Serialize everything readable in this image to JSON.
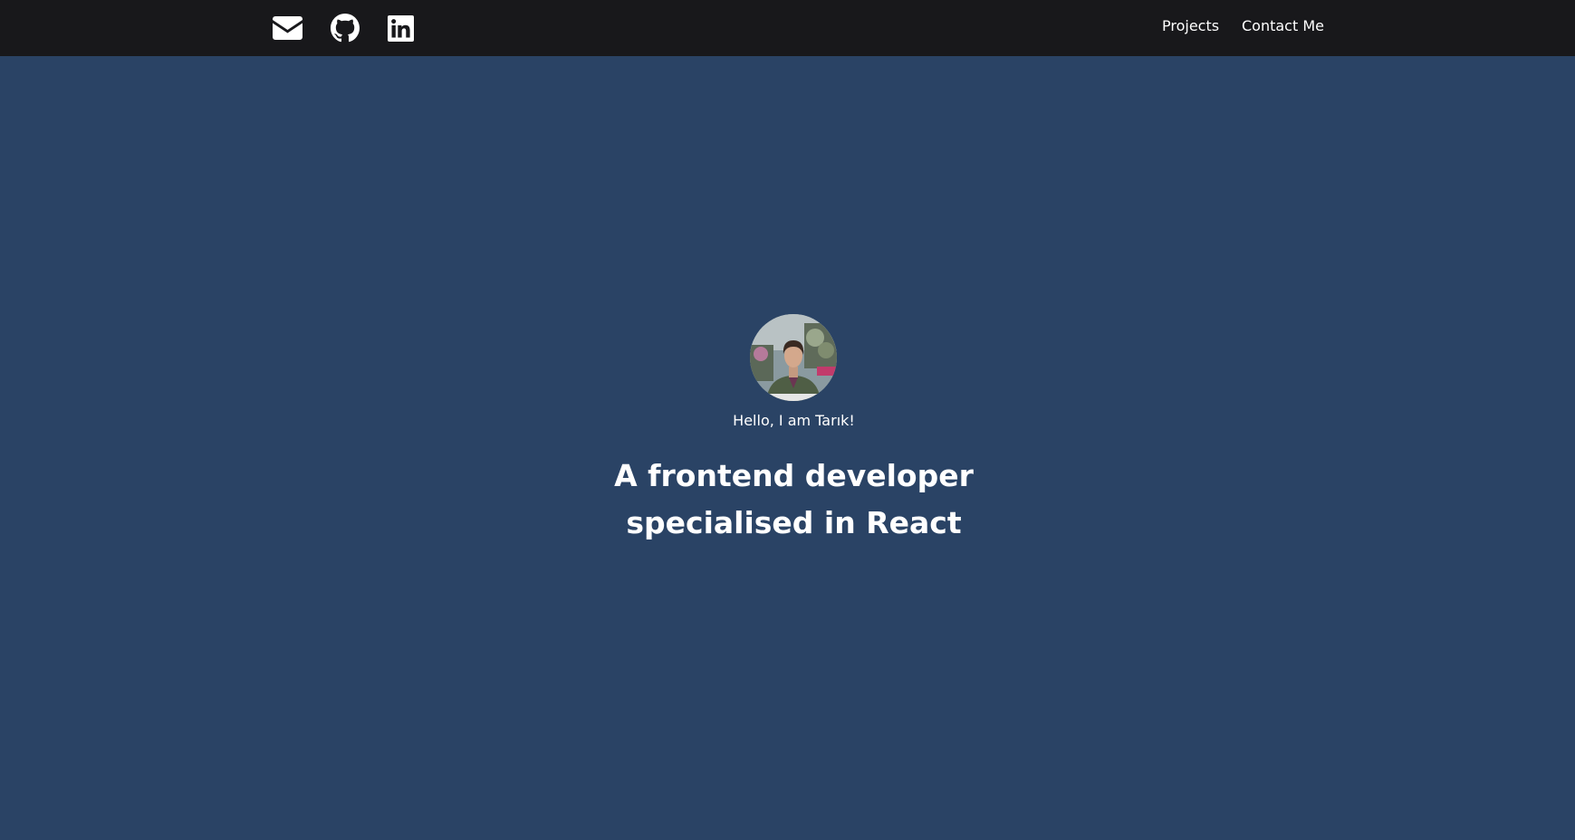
{
  "theme": {
    "topbar_bg": "#18181b",
    "page_bg": "#2a4365",
    "text_color": "#ffffff"
  },
  "header": {
    "social_links": [
      {
        "icon": "envelope-icon",
        "label": "Email"
      },
      {
        "icon": "github-icon",
        "label": "GitHub"
      },
      {
        "icon": "linkedin-icon",
        "label": "LinkedIn"
      }
    ],
    "nav": {
      "projects_label": "Projects",
      "contact_label": "Contact Me"
    }
  },
  "hero": {
    "avatar": "profile-photo",
    "greeting": "Hello, I am Tarık!",
    "headline_line1": "A frontend developer",
    "headline_line2": "specialised in React"
  }
}
